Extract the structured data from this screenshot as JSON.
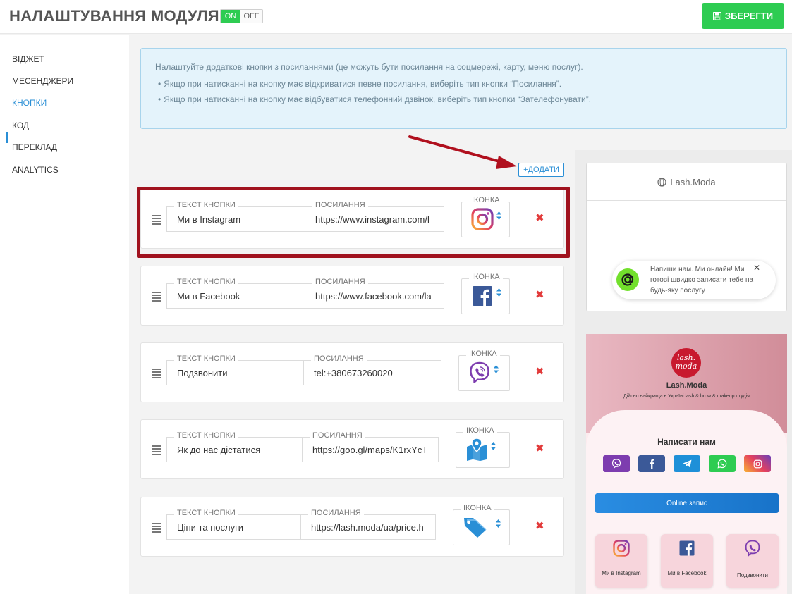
{
  "header": {
    "title": "НАЛАШТУВАННЯ МОДУЛЯ",
    "toggle_on": "ON",
    "toggle_off": "OFF",
    "save_label": "ЗБЕРЕГТИ"
  },
  "sidebar": {
    "items": [
      {
        "label": "ВІДЖЕТ"
      },
      {
        "label": "МЕСЕНДЖЕРИ"
      },
      {
        "label": "КНОПКИ"
      },
      {
        "label": "КОД"
      },
      {
        "label": "ПЕРЕКЛАД"
      },
      {
        "label": "ANALYTICS"
      }
    ],
    "active_index": 2
  },
  "info": {
    "lead": "Налаштуйте додаткові кнопки з посиланнями (це можуть бути посилання на соцмережі, карту, меню послуг).",
    "bullets": [
      "Якщо при натисканні на кнопку має відкриватися певне посилання, виберіть тип кнопки “Посилання”.",
      "Якщо при натисканні на кнопку має відбуватися телефонний дзвінок, виберіть тип кнопки “Зателефонувати”."
    ]
  },
  "add_label": "+ДОДАТИ",
  "labels": {
    "text": "ТЕКСТ КНОПКИ",
    "link": "ПОСИЛАННЯ",
    "icon": "ІКОНКА"
  },
  "rows": [
    {
      "text": "Ми в Instagram",
      "link": "https://www.instagram.com/l",
      "icon": "instagram-icon"
    },
    {
      "text": "Ми в Facebook",
      "link": "https://www.facebook.com/la",
      "icon": "facebook-icon"
    },
    {
      "text": "Подзвонити",
      "link": "tel:+380673260020",
      "icon": "viber-icon"
    },
    {
      "text": "Як до нас дістатися",
      "link": "https://goo.gl/maps/K1rxYcT",
      "icon": "map-icon"
    },
    {
      "text": "Ціни та послуги",
      "link": "https://lash.moda/ua/price.h",
      "icon": "tag-icon"
    }
  ],
  "preview": {
    "site": "Lash.Moda",
    "bubble": "Напиши нам. Ми онлайн! Ми готові швидко записати тебе на будь-яку послугу",
    "logo_line1": "lash.",
    "logo_line2": "moda",
    "brand": "Lash.Moda",
    "tagline": "Дійсно найкраща в Україні lash & brow & makeup студія",
    "write_us": "Написати нам",
    "online": "Online запис",
    "tiles": [
      "Ми в Instagram",
      "Ми в Facebook",
      "Подзвонити"
    ]
  },
  "colors": {
    "accent": "#2a8fd6",
    "success": "#2ecc52",
    "danger": "#e23a3a",
    "highlight": "#a0121e"
  }
}
